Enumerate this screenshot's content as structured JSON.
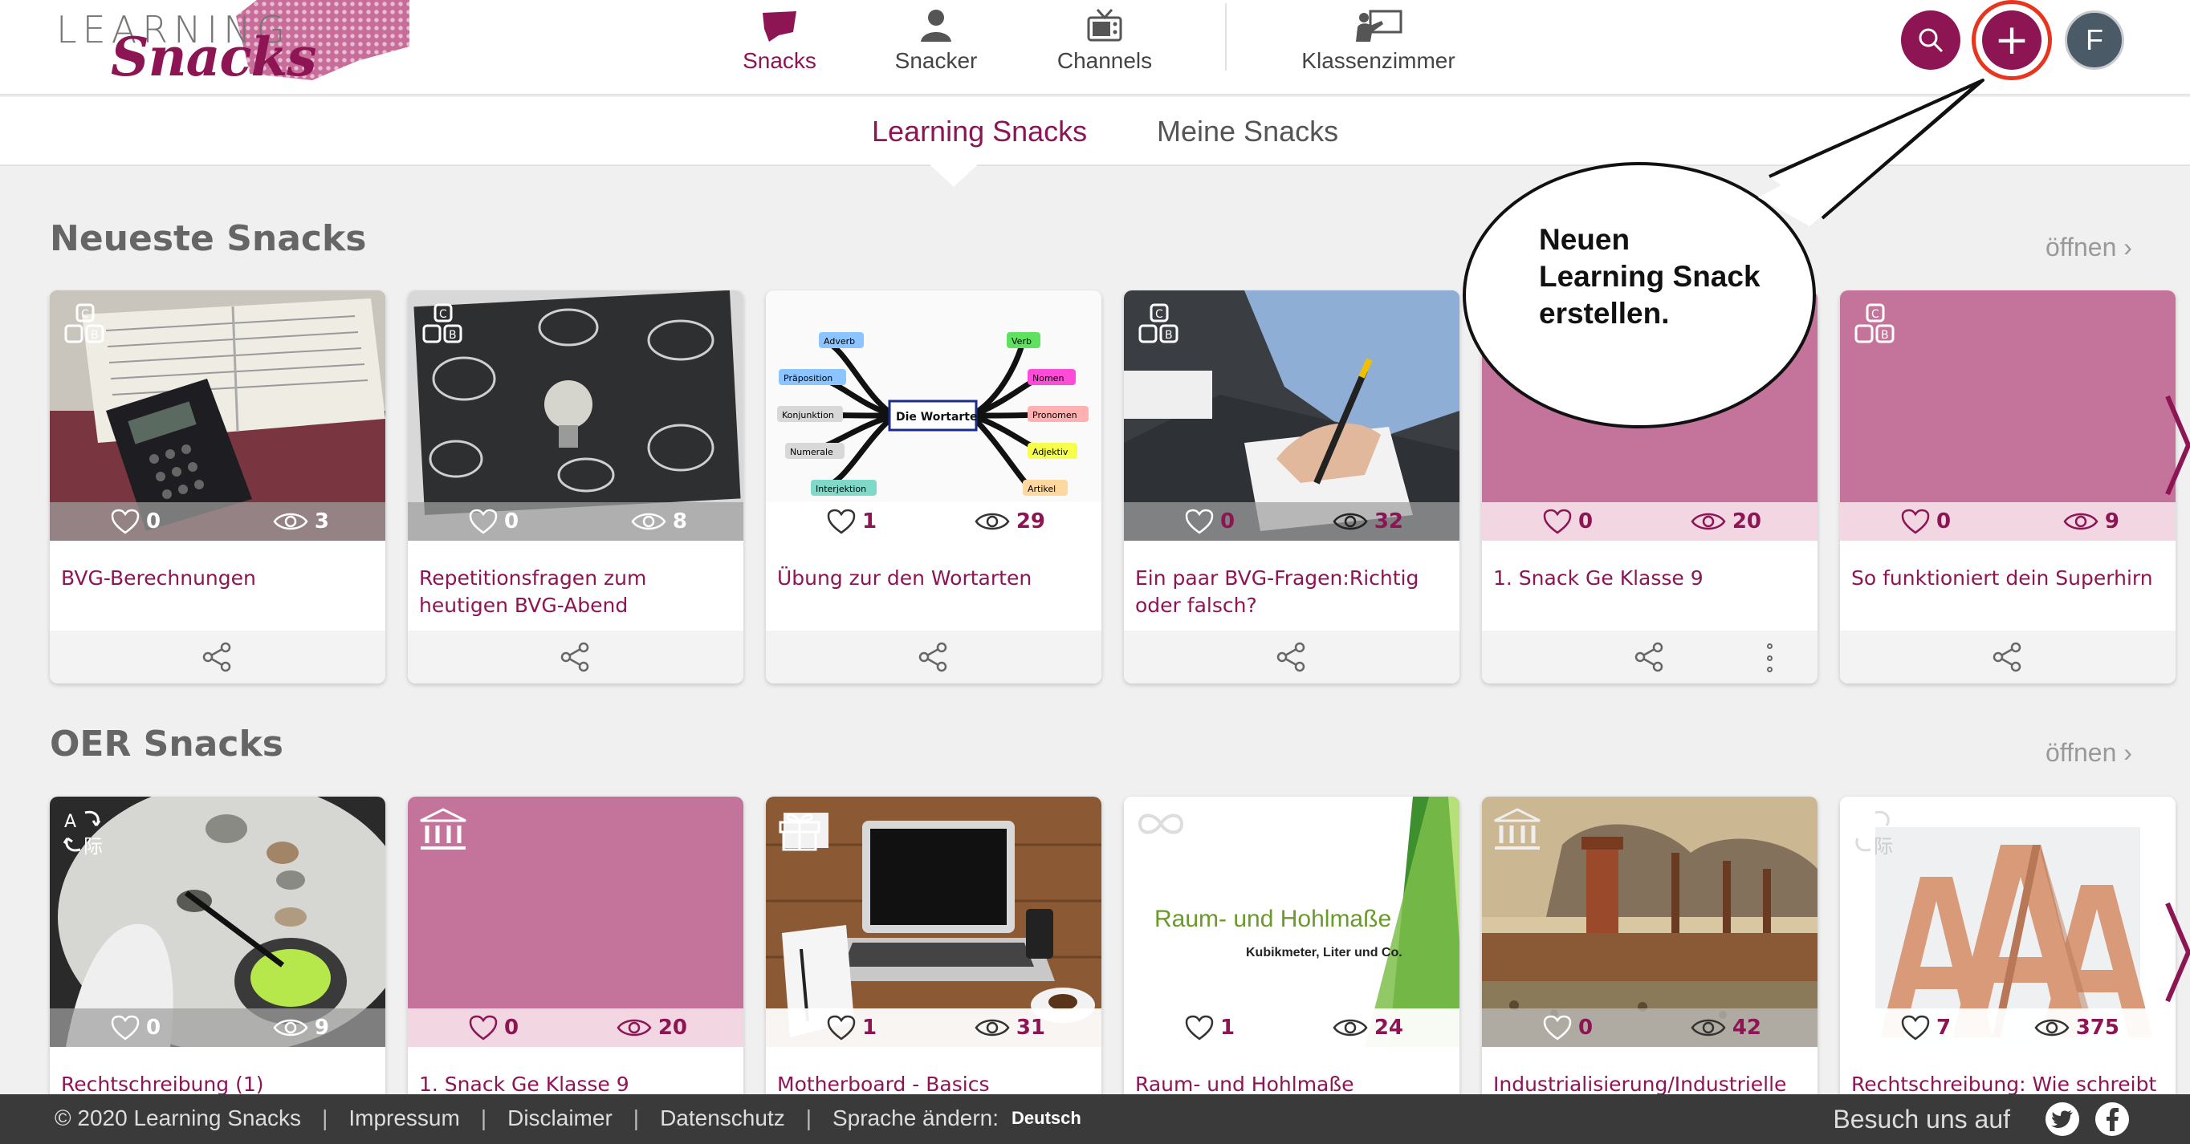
{
  "logo": {
    "line1": "LEARNING",
    "line2": "Snacks"
  },
  "nav": {
    "items": [
      {
        "label": "Snacks",
        "icon": "snacks-icon"
      },
      {
        "label": "Snacker",
        "icon": "user-icon"
      },
      {
        "label": "Channels",
        "icon": "tv-icon"
      },
      {
        "label": "Klassenzimmer",
        "icon": "teacher-board-icon"
      }
    ],
    "add_label": "+",
    "avatar_initial": "F"
  },
  "subnav": {
    "tabs": [
      "Learning Snacks",
      "Meine Snacks"
    ]
  },
  "callout": {
    "lines": [
      "Neuen",
      "Learning Snack",
      "erstellen."
    ]
  },
  "sections": [
    {
      "title": "Neueste Snacks",
      "open_label": "öffnen ›",
      "cards": [
        {
          "title": "BVG-Berechnungen",
          "likes": "0",
          "views": "3"
        },
        {
          "title": "Repetitionsfragen zum heutigen BVG-Abend",
          "likes": "0",
          "views": "8"
        },
        {
          "title": "Übung zur den Wortarten",
          "likes": "1",
          "views": "29"
        },
        {
          "title": "Ein paar BVG-Fragen:Richtig oder falsch?",
          "likes": "0",
          "views": "32"
        },
        {
          "title": "1. Snack Ge Klasse 9",
          "likes": "0",
          "views": "20"
        },
        {
          "title": "So funktioniert dein Superhirn",
          "likes": "0",
          "views": "9"
        }
      ]
    },
    {
      "title": "OER Snacks",
      "open_label": "öffnen ›",
      "cards": [
        {
          "title": "Rechtschreibung (1)",
          "likes": "0",
          "views": "9"
        },
        {
          "title": "1. Snack Ge Klasse 9",
          "likes": "0",
          "views": "20"
        },
        {
          "title": "Motherboard - Basics",
          "likes": "1",
          "views": "31"
        },
        {
          "title": "Raum- und Hohlmaße",
          "likes": "1",
          "views": "24"
        },
        {
          "title": "Industrialisierung/Industrielle",
          "likes": "0",
          "views": "42"
        },
        {
          "title": "Rechtschreibung: Wie schreibt",
          "likes": "7",
          "views": "375"
        }
      ]
    }
  ],
  "mindmap": {
    "center": "Die Wortarten",
    "nodes": [
      "Adverb",
      "Präposition",
      "Konjunktion",
      "Numerale",
      "Interjektion",
      "Verb",
      "Nomen",
      "Pronomen",
      "Adjektiv",
      "Artikel"
    ]
  },
  "raum_slide": {
    "title": "Raum- und Hohlmaße",
    "subtitle": "Kubikmeter, Liter und Co."
  },
  "footer": {
    "copyright": "© 2020 Learning Snacks",
    "links": [
      "Impressum",
      "Disclaimer",
      "Datenschutz"
    ],
    "language_label": "Sprache ändern:",
    "language_value": "Deutsch",
    "social_label": "Besuch uns auf"
  },
  "colors": {
    "brand": "#8d1554",
    "card_pink": "#c4739b",
    "footer": "#3a3a3a"
  }
}
